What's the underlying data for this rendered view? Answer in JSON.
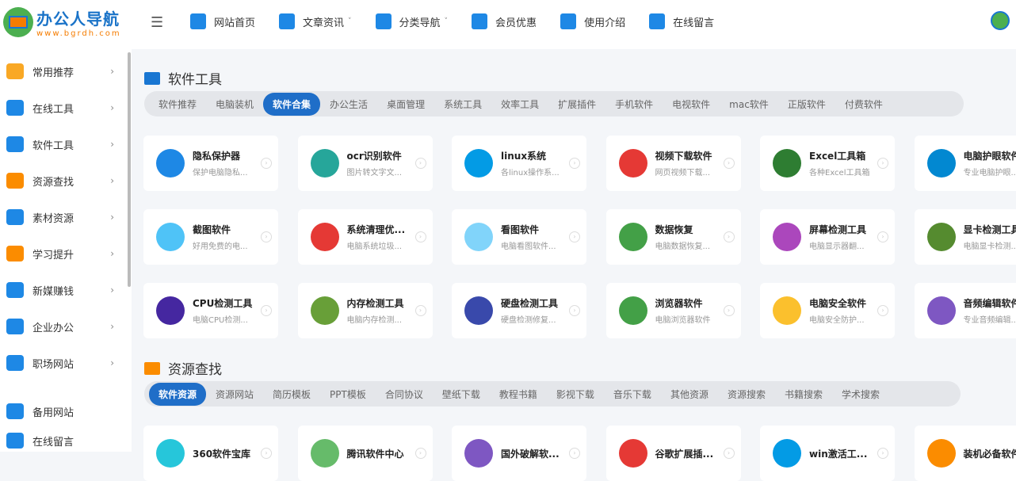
{
  "logo": {
    "title": "办公人导航",
    "url": "www.bgrdh.com"
  },
  "nav": [
    {
      "label": "网站首页",
      "color": "#1e88e5"
    },
    {
      "label": "文章资讯",
      "color": "#1e88e5",
      "caret": "˅"
    },
    {
      "label": "分类导航",
      "color": "#1e88e5",
      "caret": "˅"
    },
    {
      "label": "会员优惠",
      "color": "#1e88e5"
    },
    {
      "label": "使用介绍",
      "color": "#1e88e5"
    },
    {
      "label": "在线留言",
      "color": "#1e88e5"
    }
  ],
  "menu_icon": "☰",
  "sidebar": [
    {
      "label": "常用推荐",
      "color": "#f9a825"
    },
    {
      "label": "在线工具",
      "color": "#1e88e5"
    },
    {
      "label": "软件工具",
      "color": "#1e88e5"
    },
    {
      "label": "资源查找",
      "color": "#fb8c00"
    },
    {
      "label": "素材资源",
      "color": "#1e88e5"
    },
    {
      "label": "学习提升",
      "color": "#fb8c00"
    },
    {
      "label": "新媒赚钱",
      "color": "#1e88e5"
    },
    {
      "label": "企业办公",
      "color": "#1e88e5"
    },
    {
      "label": "职场网站",
      "color": "#1e88e5"
    },
    {
      "label": "备用网站",
      "color": "#1e88e5"
    },
    {
      "label": "在线留言",
      "color": "#1e88e5"
    }
  ],
  "section1": {
    "title": "软件工具",
    "tabs": [
      "软件推荐",
      "电脑装机",
      "软件合集",
      "办公生活",
      "桌面管理",
      "系统工具",
      "效率工具",
      "扩展插件",
      "手机软件",
      "电视软件",
      "mac软件",
      "正版软件",
      "付费软件"
    ],
    "active": 2,
    "cards": [
      {
        "title": "隐私保护器",
        "desc": "保护电脑隐私...",
        "color": "#1e88e5"
      },
      {
        "title": "ocr识别软件",
        "desc": "图片转文字文...",
        "color": "#26a69a"
      },
      {
        "title": "linux系统",
        "desc": "各linux操作系...",
        "color": "#039be5"
      },
      {
        "title": "视频下载软件",
        "desc": "网页视频下载...",
        "color": "#e53935"
      },
      {
        "title": "Excel工具箱",
        "desc": "各种Excel工具箱",
        "color": "#2e7d32"
      },
      {
        "title": "电脑护眼软件",
        "desc": "专业电脑护眼...",
        "color": "#0288d1"
      },
      {
        "title": "截图软件",
        "desc": "好用免费的电...",
        "color": "#4fc3f7"
      },
      {
        "title": "系统清理优...",
        "desc": "电脑系统垃圾...",
        "color": "#e53935"
      },
      {
        "title": "看图软件",
        "desc": "电脑看图软件...",
        "color": "#81d4fa"
      },
      {
        "title": "数据恢复",
        "desc": "电脑数据恢复...",
        "color": "#43a047"
      },
      {
        "title": "屏幕检测工具",
        "desc": "电脑显示器翻...",
        "color": "#ab47bc"
      },
      {
        "title": "显卡检测工具",
        "desc": "电脑显卡检测...",
        "color": "#558b2f"
      },
      {
        "title": "CPU检测工具",
        "desc": "电脑CPU检测...",
        "color": "#4527a0"
      },
      {
        "title": "内存检测工具",
        "desc": "电脑内存检测...",
        "color": "#689f38"
      },
      {
        "title": "硬盘检测工具",
        "desc": "硬盘检测修复...",
        "color": "#3949ab"
      },
      {
        "title": "浏览器软件",
        "desc": "电脑浏览器软件",
        "color": "#43a047"
      },
      {
        "title": "电脑安全软件",
        "desc": "电脑安全防护...",
        "color": "#fbc02d"
      },
      {
        "title": "音频编辑软件",
        "desc": "专业音频编辑...",
        "color": "#7e57c2"
      }
    ]
  },
  "section2": {
    "title": "资源查找",
    "tabs": [
      "软件资源",
      "资源网站",
      "简历模板",
      "PPT模板",
      "合同协议",
      "壁纸下载",
      "教程书籍",
      "影视下载",
      "音乐下载",
      "其他资源",
      "资源搜索",
      "书籍搜索",
      "学术搜索"
    ],
    "active": 0,
    "cards": [
      {
        "title": "360软件宝库",
        "color": "#26c6da"
      },
      {
        "title": "腾讯软件中心",
        "color": "#66bb6a"
      },
      {
        "title": "国外破解软...",
        "color": "#7e57c2"
      },
      {
        "title": "谷歌扩展插...",
        "color": "#e53935"
      },
      {
        "title": "win激活工...",
        "color": "#039be5"
      },
      {
        "title": "装机必备软件",
        "color": "#fb8c00"
      }
    ]
  }
}
